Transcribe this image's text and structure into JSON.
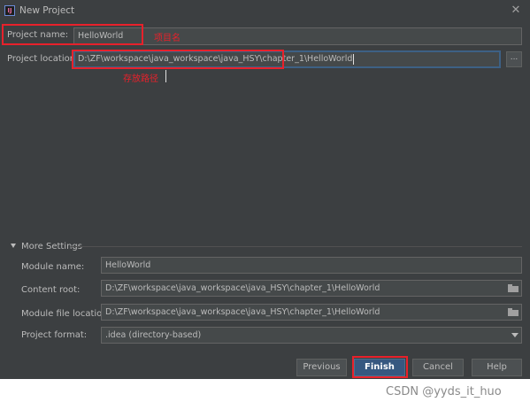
{
  "window": {
    "title": "New Project",
    "close_icon": "close-icon"
  },
  "form": {
    "project_name_label": "Project name:",
    "project_name_value": "HelloWorld",
    "project_location_label": "Project location:",
    "project_location_value": "D:\\ZF\\workspace\\java_workspace\\java_HSY\\chapter_1\\HelloWorld",
    "browse_label": "..."
  },
  "annotations": {
    "project_name_note": "项目名",
    "location_note": "存放路径",
    "color": "#e8212b"
  },
  "more_settings": {
    "header": "More Settings",
    "module_name_label": "Module name:",
    "module_name_value": "HelloWorld",
    "content_root_label": "Content root:",
    "content_root_value": "D:\\ZF\\workspace\\java_workspace\\java_HSY\\chapter_1\\HelloWorld",
    "module_file_location_label": "Module file location:",
    "module_file_location_value": "D:\\ZF\\workspace\\java_workspace\\java_HSY\\chapter_1\\HelloWorld",
    "project_format_label": "Project format:",
    "project_format_value": ".idea (directory-based)"
  },
  "buttons": {
    "previous": "Previous",
    "finish": "Finish",
    "cancel": "Cancel",
    "help": "Help"
  },
  "watermark": "CSDN @yyds_it_huo",
  "colors": {
    "dialog_bg": "#3c3f41",
    "field_bg": "#45494a",
    "accent": "#365880",
    "focus_border": "#3d6185"
  }
}
